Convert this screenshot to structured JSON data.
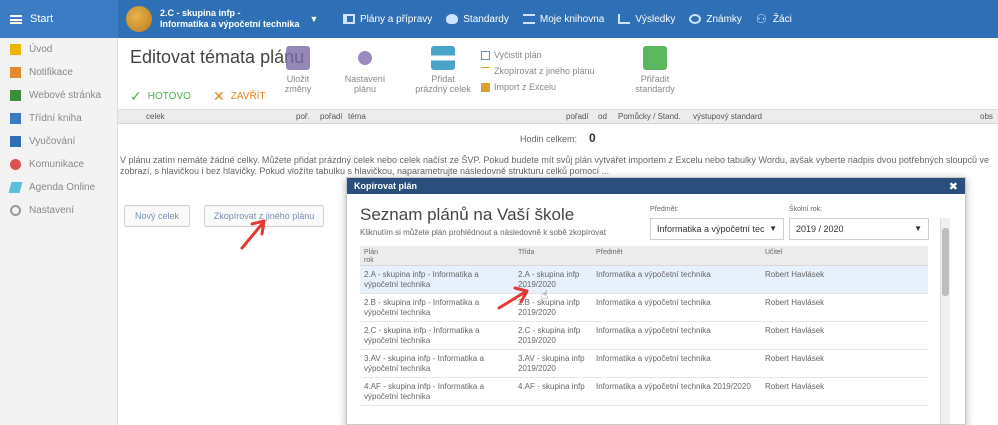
{
  "topbar": {
    "start_label": "Start",
    "group_line1": "2.C - skupina infp -",
    "group_line2": "Informatika a výpočetní technika",
    "nav": [
      {
        "label": "Plány a přípravy",
        "icon": "plan-icon"
      },
      {
        "label": "Standardy",
        "icon": "standard-icon"
      },
      {
        "label": "Moje knihovna",
        "icon": "library-icon"
      },
      {
        "label": "Výsledky",
        "icon": "results-icon"
      },
      {
        "label": "Známky",
        "icon": "grades-icon"
      },
      {
        "label": "Žáci",
        "icon": "students-icon"
      }
    ]
  },
  "sidebar": {
    "items": [
      {
        "label": "Úvod",
        "color": "#f0b400"
      },
      {
        "label": "Notifikace",
        "color": "#e58a2e"
      },
      {
        "label": "Webové stránka",
        "color": "#3a8f3a"
      },
      {
        "label": "Třídní kniha",
        "color": "#3a7cc4"
      },
      {
        "label": "Vyučování",
        "color": "#2f6fb5"
      },
      {
        "label": "Komunikace",
        "color": "#d9534f"
      },
      {
        "label": "Agenda Online",
        "color": "#5bc0de"
      },
      {
        "label": "Nastavení",
        "color": "#999999"
      }
    ]
  },
  "toolbar": {
    "title": "Editovat témata plánu",
    "done_label": "HOTOVO",
    "close_label": "ZAVŘÍT",
    "save_line1": "Uložit",
    "save_line2": "změny",
    "settings_line1": "Nastavení",
    "settings_line2": "plánu",
    "add_line1": "Přidat",
    "add_line2": "prázdný celek",
    "clear_label": "Vyčistit plán",
    "copy_other_label": "Zkopírovat z jiného plánu",
    "import_excel_label": "Import z Excelu",
    "std_line1": "Přiřadit",
    "std_line2": "standardy"
  },
  "strip": {
    "col_unit": "celek",
    "col_order": "poř.",
    "col_lesson": "pořadí",
    "col_topic": "téma",
    "col_date": "pořadí",
    "col_from": "od",
    "col_aids": "Pomůcky / Stand.",
    "col_output": "výstupový standard",
    "col_content": "obs"
  },
  "hours": {
    "label": "Hodin celkem:",
    "value": "0"
  },
  "info_line1": "V plánu zatím nemáte žádné celky. Můžete přidat prázdný celek nebo celek načíst ze ŠVP. Pokud budete mít svůj plán vytvářet importem z Excelu nebo tabulky Wordu, avšak vyberte nadpis dvou potřebných sloupců ve",
  "info_line2": "zobrazí, s hlavičkou i bez hlavičky. Pokud vložíte tabulku s hlavičkou, naparametrujte následovně strukturu celků pomocí ...",
  "buttons": {
    "new_unit": "Nový celek",
    "copy_from": "Zkopírovat z jiného plánu"
  },
  "modal": {
    "header": "Kopírovat plán",
    "title": "Seznam plánů na Vaší škole",
    "subtitle": "Kliknutím si můžete plán prohlédnout a následovně k sobě zkopírovat",
    "subject_label": "Předmět:",
    "subject_value": "Informatika a výpočetní tec",
    "year_label": "Školní rok:",
    "year_value": "2019 / 2020",
    "col_plan_line1": "Plán",
    "col_plan_line2": "rok",
    "col_title": "Třída",
    "col_subject": "Předmět",
    "col_teacher": "Učitel",
    "rows": [
      {
        "plan": "2.A - skupina infp - Informatika a výpočetní technika",
        "cls": "2.A - skupina infp 2019/2020",
        "subject": "Informatika a výpočetní technika",
        "teacher": "Robert Havlásek"
      },
      {
        "plan": "2.B - skupina infp - Informatika a výpočetní technika",
        "cls": "2.B - skupina infp 2019/2020",
        "subject": "Informatika a výpočetní technika",
        "teacher": "Robert Havlásek"
      },
      {
        "plan": "2.C - skupina infp - Informatika a výpočetní technika",
        "cls": "2.C - skupina infp 2019/2020",
        "subject": "Informatika a výpočetní technika",
        "teacher": "Robert Havlásek"
      },
      {
        "plan": "3.AV - skupina infp - Informatika a výpočetní technika",
        "cls": "3.AV - skupina infp 2019/2020",
        "subject": "Informatika a výpočetní technika",
        "teacher": "Robert Havlásek"
      },
      {
        "plan": "4.AF - skupina infp - Informatika a výpočetní technika",
        "cls": "4.AF - skupina infp",
        "subject": "Informatika a výpočetní technika 2019/2020",
        "teacher": "Robert Havlásek"
      }
    ]
  },
  "colors": {
    "topbar": "#2f6fb5",
    "modal_header": "#2a4f7c",
    "done": "#4caf50",
    "close": "#ef7f1a",
    "arrow": "#e53935",
    "row_highlight": "#e7f1fb"
  }
}
